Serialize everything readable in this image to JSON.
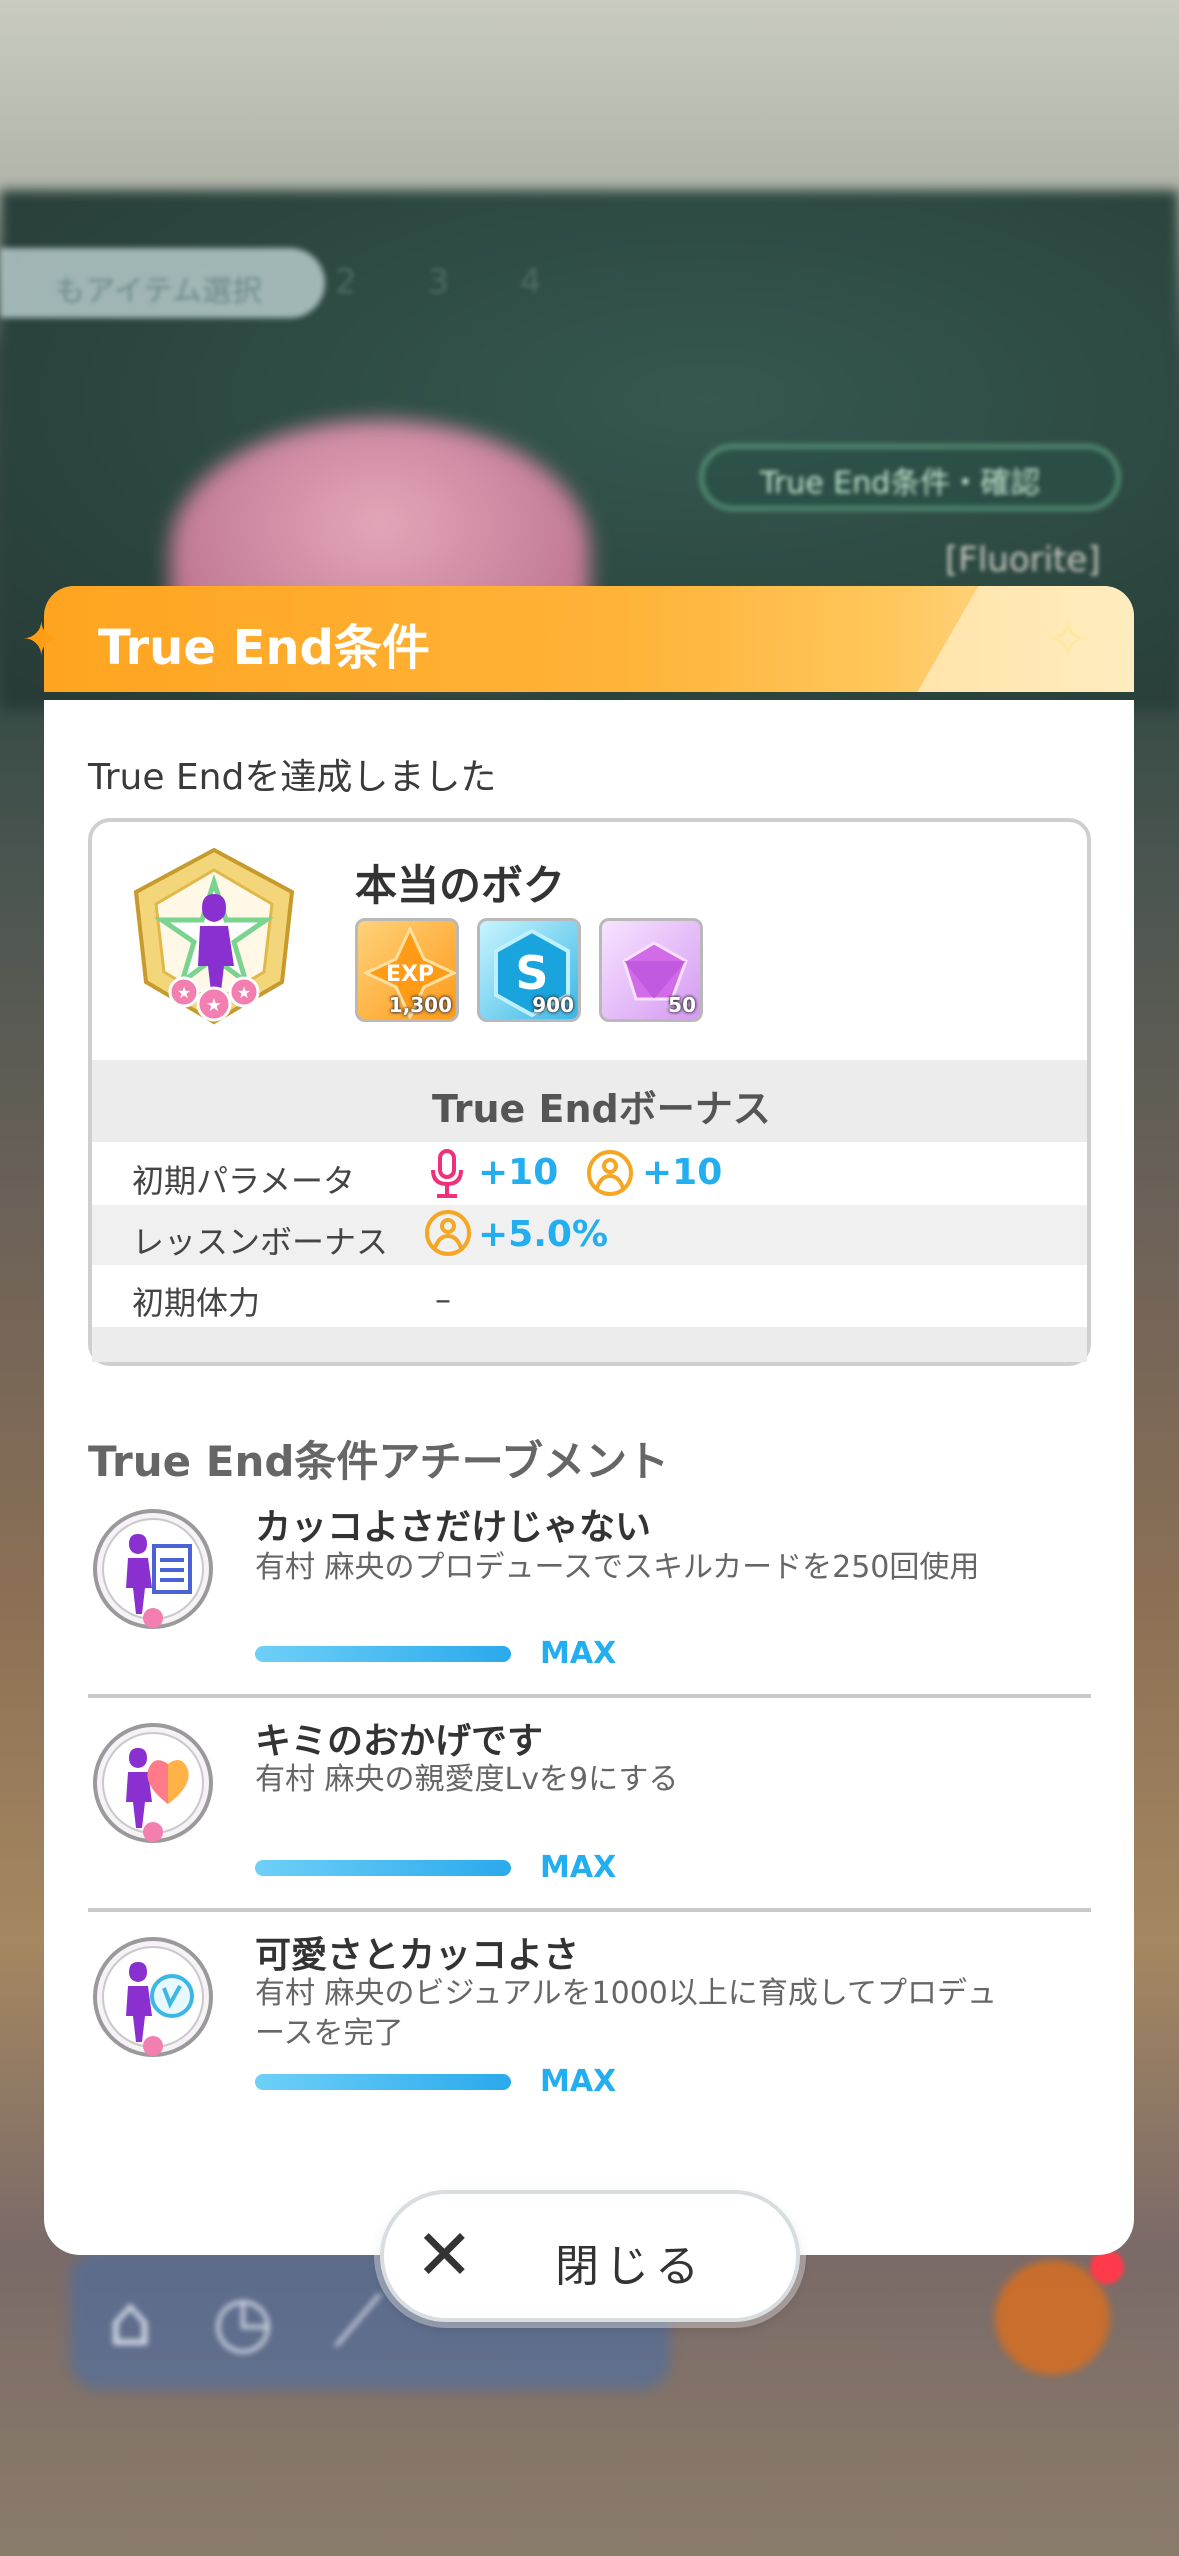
{
  "background": {
    "pill_text": "もアイテム選択",
    "step_numbers": "2 3 4",
    "condition_button": "True End条件・確認",
    "name_label": "[Fluorite]"
  },
  "modal": {
    "title": "True End条件",
    "achieved_message": "True Endを達成しました",
    "reward": {
      "title": "本当のボク",
      "items": [
        {
          "icon": "exp-item-icon",
          "label": "EXP",
          "count": "1,300"
        },
        {
          "icon": "s-badge-item-icon",
          "label": "S",
          "count": "900"
        },
        {
          "icon": "pink-gem-item-icon",
          "label": "",
          "count": "50"
        }
      ]
    },
    "bonus": {
      "header": "True Endボーナス",
      "rows": [
        {
          "label": "初期パラメータ",
          "values": [
            "+10",
            "+10"
          ],
          "icons": [
            "vocal-mic-icon",
            "dance-icon"
          ]
        },
        {
          "label": "レッスンボーナス",
          "values": [
            "+5.0%"
          ],
          "icons": [
            "dance-icon"
          ]
        },
        {
          "label": "初期体力",
          "values": [
            "–"
          ]
        }
      ]
    },
    "achievements_heading": "True End条件アチーブメント",
    "achievements": [
      {
        "title": "カッコよさだけじゃない",
        "desc": "有村 麻央のプロデュースでスキルカードを250回使用",
        "progress": 1.0,
        "status": "MAX"
      },
      {
        "title": "キミのおかげです",
        "desc": "有村 麻央の親愛度Lvを9にする",
        "progress": 1.0,
        "status": "MAX"
      },
      {
        "title": "可愛さとカッコよさ",
        "desc": "有村 麻央のビジュアルを1000以上に育成してプロデュースを完了",
        "progress": 1.0,
        "status": "MAX"
      }
    ],
    "close_label": "閉じる"
  },
  "colors": {
    "header_orange": "#ffa420",
    "accent_blue": "#23aef0",
    "vocal_pink": "#f0307a",
    "dance_orange": "#f5a623"
  }
}
